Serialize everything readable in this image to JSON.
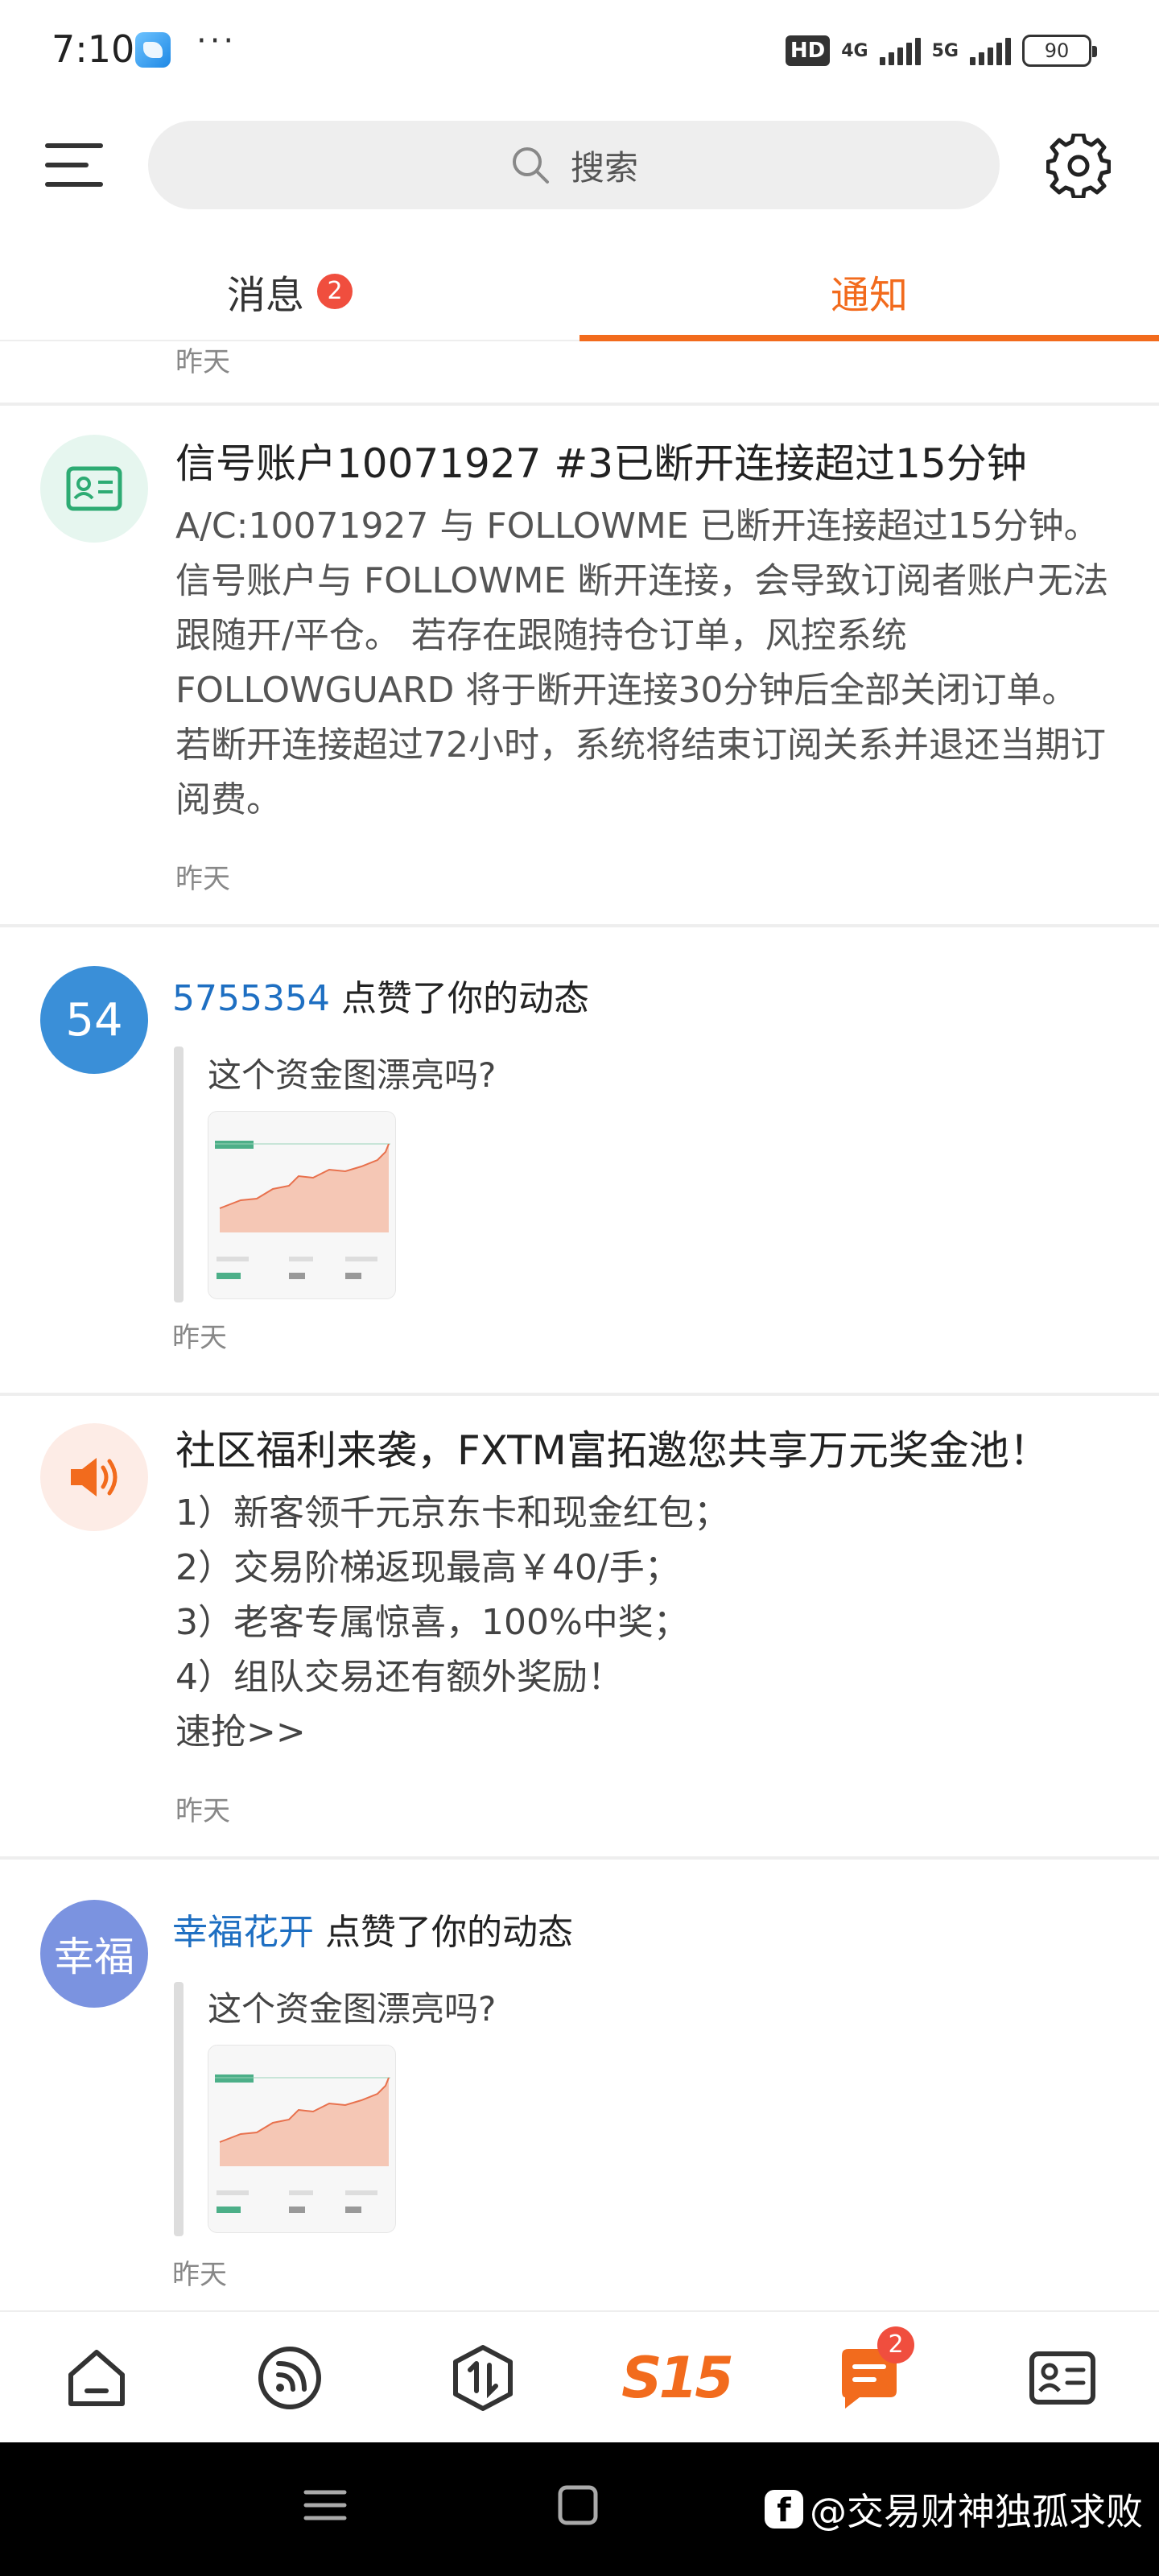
{
  "status_bar": {
    "time": "7:10",
    "dots": "···",
    "hd": "HD",
    "net1": "4G",
    "net2": "5G",
    "battery": "90"
  },
  "search": {
    "placeholder": "搜索"
  },
  "tabs": {
    "messages_label": "消息",
    "messages_badge": "2",
    "notices_label": "通知"
  },
  "feed": {
    "top_time": "昨天",
    "signal_notice": {
      "title": "信号账户10071927 #3已断开连接超过15分钟",
      "body": "A/C:10071927 与 FOLLOWME 已断开连接超过15分钟。 信号账户与 FOLLOWME 断开连接，会导致订阅者账户无法跟随开/平仓。 若存在跟随持仓订单，风控系统 FOLLOWGUARD 将于断开连接30分钟后全部关闭订单。 若断开连接超过72小时，系统将结束订阅关系并退还当期订阅费。",
      "time": "昨天"
    },
    "like1": {
      "avatar_text": "54",
      "user": "5755354",
      "action": " 点赞了你的动态",
      "quote": "这个资金图漂亮吗?",
      "time": "昨天"
    },
    "promo": {
      "title": "社区福利来袭，FXTM富拓邀您共享万元奖金池！",
      "lines": [
        "1）新客领千元京东卡和现金红包；",
        "2）交易阶梯返现最高￥40/手；",
        "3）老客专属惊喜，100%中奖；",
        "4）组队交易还有额外奖励！",
        "速抢>>"
      ],
      "time": "昨天"
    },
    "like2": {
      "avatar_text": "幸福",
      "user": "幸福花开",
      "action": " 点赞了你的动态",
      "quote": "这个资金图漂亮吗?",
      "time": "昨天"
    }
  },
  "bottom_nav": {
    "s15_label": "S15",
    "messages_badge": "2"
  },
  "watermark": {
    "logo_letter": "f",
    "text": "@交易财神独孤求败"
  },
  "colors": {
    "accent": "#f26b1d",
    "badge": "#f04e3e",
    "link_user": "#1e6fc2",
    "avatar_blue": "#3a8fd8",
    "avatar_purple": "#7b93e0"
  }
}
